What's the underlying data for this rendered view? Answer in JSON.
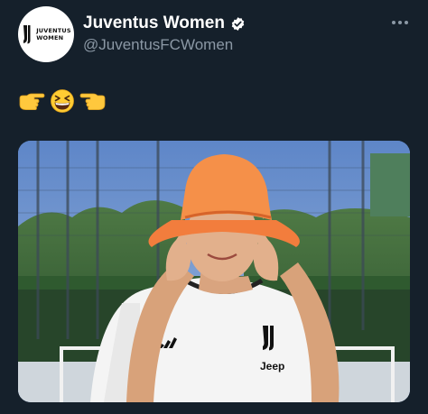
{
  "account": {
    "avatar_wordmark_line1": "JUVENTUS",
    "avatar_wordmark_line2": "WOMEN",
    "display_name": "Juventus Women",
    "handle": "@JuventusFCWomen",
    "verified": true
  },
  "tweet": {
    "emojis": [
      "pointing-right-hand",
      "grinning-squinting-face",
      "pointing-left-hand"
    ]
  },
  "media": {
    "shirt_crest": "J",
    "shirt_sponsor": "Jeep"
  },
  "colors": {
    "background": "#15202b",
    "secondary_text": "#8b98a5",
    "verified_badge": "#ffffff",
    "hat_orange": "#f07a3c"
  }
}
